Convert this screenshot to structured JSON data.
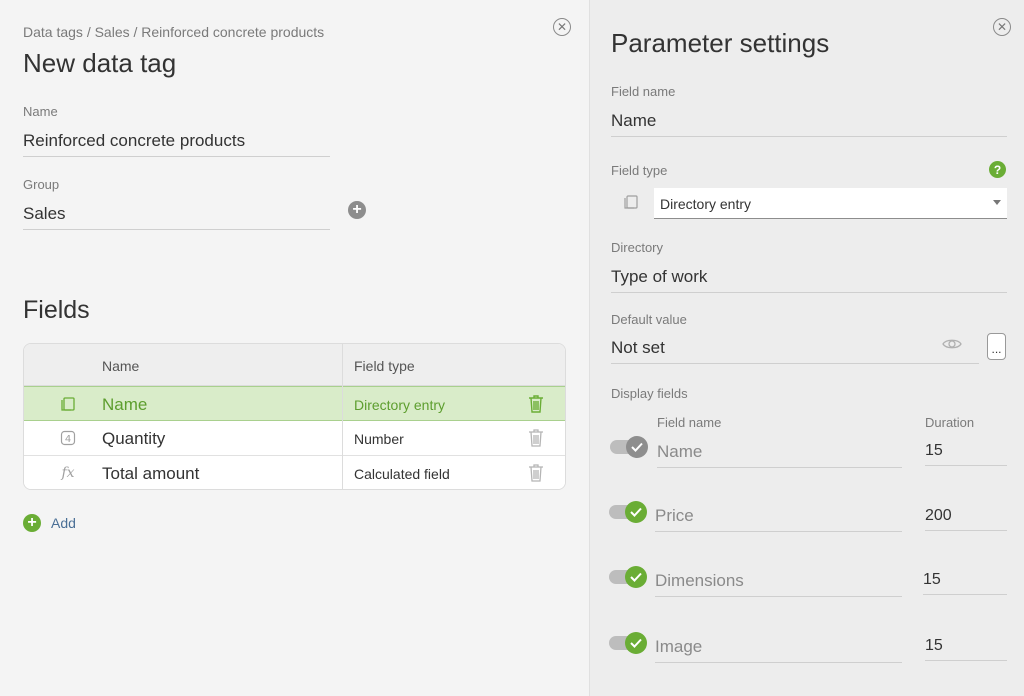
{
  "left": {
    "breadcrumb": "Data tags / Sales / Reinforced concrete products",
    "title": "New data tag",
    "name_label": "Name",
    "name_value": "Reinforced concrete products",
    "group_label": "Group",
    "group_value": "Sales",
    "fields_title": "Fields",
    "table": {
      "headers": [
        "Name",
        "Field type"
      ],
      "rows": [
        {
          "icon": "directory-icon",
          "name": "Name",
          "type": "Directory entry",
          "selected": true
        },
        {
          "icon": "number-icon",
          "name": "Quantity",
          "type": "Number",
          "selected": false
        },
        {
          "icon": "formula-icon",
          "name": "Total amount",
          "type": "Calculated field",
          "selected": false
        }
      ]
    },
    "add_label": "Add"
  },
  "right": {
    "title": "Parameter settings",
    "field_name_label": "Field name",
    "field_name_value": "Name",
    "field_type_label": "Field type",
    "field_type_value": "Directory entry",
    "help_glyph": "?",
    "directory_label": "Directory",
    "directory_value": "Type of work",
    "default_label": "Default value",
    "default_value": "Not set",
    "dots_label": "...",
    "display_fields_label": "Display fields",
    "col_field_name": "Field name",
    "col_duration": "Duration",
    "display_fields": [
      {
        "name": "Name",
        "duration": "15",
        "enabled": true,
        "locked": true
      },
      {
        "name": "Price",
        "duration": "200",
        "enabled": true,
        "locked": false
      },
      {
        "name": "Dimensions",
        "duration": "15",
        "enabled": true,
        "locked": false
      },
      {
        "name": "Image",
        "duration": "15",
        "enabled": true,
        "locked": false
      }
    ]
  },
  "colors": {
    "accent_green": "#6aad35",
    "selected_row_bg": "#d9ecc9",
    "link_blue": "#4a6f96"
  }
}
